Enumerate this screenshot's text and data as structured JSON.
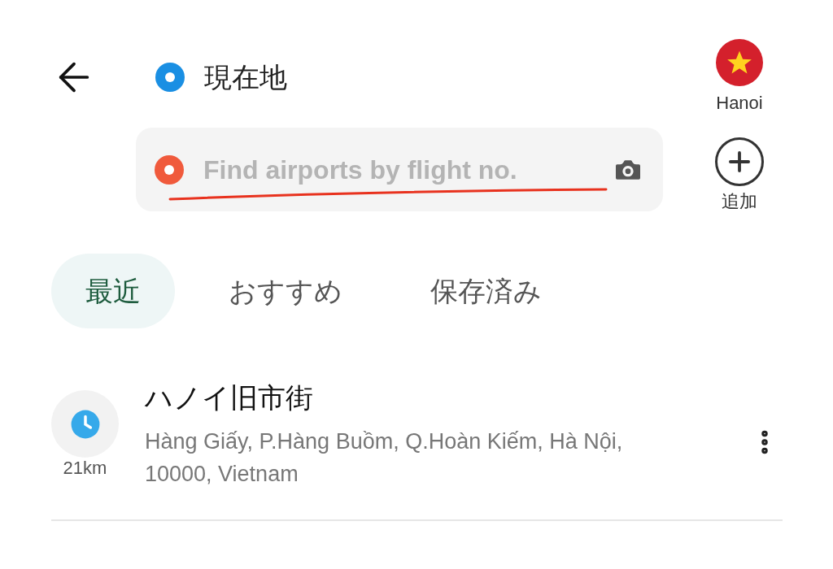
{
  "header": {
    "origin": "現在地",
    "search": {
      "placeholder": "Find airports by flight no."
    },
    "city": {
      "label": "Hanoi"
    },
    "add": {
      "label": "追加"
    }
  },
  "tabs": [
    {
      "label": "最近",
      "selected": true
    },
    {
      "label": "おすすめ",
      "selected": false
    },
    {
      "label": "保存済み",
      "selected": false
    }
  ],
  "places": [
    {
      "title": "ハノイ旧市街",
      "address": "Hàng Giấy, P.Hàng Buồm, Q.Hoàn Kiếm, Hà Nội, 10000, Vietnam",
      "distance": "21km"
    }
  ]
}
